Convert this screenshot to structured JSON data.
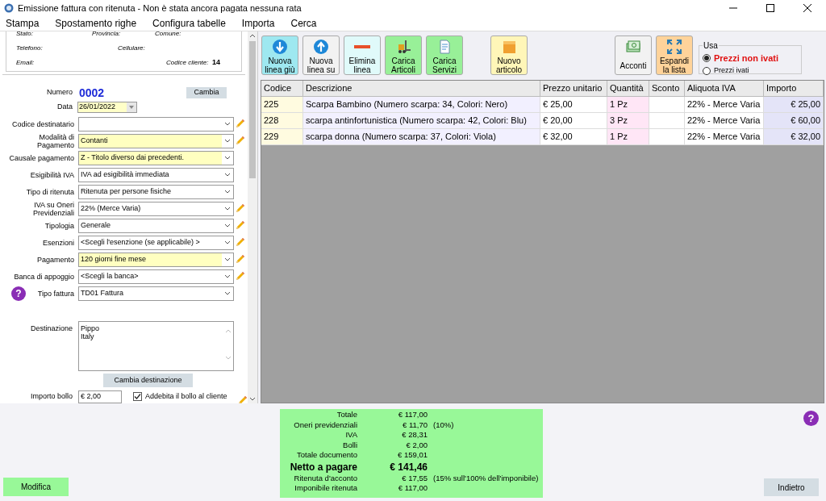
{
  "window": {
    "title": "Emissione fattura con ritenuta - Non è stata ancora pagata nessuna rata"
  },
  "menu": [
    "Stampa",
    "Spostamento righe",
    "Configura tabelle",
    "Importa",
    "Cerca"
  ],
  "customer": {
    "stato": "Stato:",
    "provincia": "Provincia:",
    "comune": "Comune:",
    "telefono": "Telefono:",
    "cellulare": "Cellulare:",
    "email": "Email:",
    "codice_label": "Codice cliente:",
    "codice": "14"
  },
  "numero": {
    "label": "Numero",
    "value": "0002",
    "button": "Cambia"
  },
  "data": {
    "label": "Data",
    "value": "26/01/2022"
  },
  "fields": [
    {
      "label": "Codice destinatario",
      "highlighted": false,
      "editable": true
    },
    {
      "label": "Modalità di Pagamento",
      "value": "Contanti",
      "highlighted": true,
      "editable": true
    },
    {
      "label": "Causale pagamento",
      "value": "Z - Titolo diverso dai precedenti.",
      "highlighted": true,
      "editable": false
    },
    {
      "label": "Esigibilità IVA",
      "value": "IVA ad esigibilità immediata",
      "highlighted": false,
      "editable": false
    },
    {
      "label": "Tipo di ritenuta",
      "value": "Ritenuta per persone fisiche",
      "highlighted": false,
      "editable": false
    },
    {
      "label": "IVA su Oneri Previdenziali",
      "value": "22% (Merce Varia)",
      "highlighted": false,
      "editable": true
    },
    {
      "label": "Tipologia",
      "value": "Generale",
      "highlighted": false,
      "editable": true
    },
    {
      "label": "Esenzioni",
      "value": "<Scegli l'esenzione (se applicabile) >",
      "highlighted": false,
      "editable": true
    },
    {
      "label": "Pagamento",
      "value": "120 giorni fine mese",
      "highlighted": true,
      "editable": true
    },
    {
      "label": "Banca di appoggio",
      "value": "<Scegli la banca>",
      "highlighted": false,
      "editable": true
    },
    {
      "label": "Tipo fattura",
      "value": "TD01 Fattura",
      "highlighted": false,
      "editable": false,
      "help": "?"
    }
  ],
  "destinazione": {
    "label": "Destinazione",
    "lines": [
      "Pippo",
      "Italy"
    ],
    "button": "Cambia destinazione"
  },
  "bollo": {
    "label": "Importo bollo",
    "value": "€ 2,00",
    "checkbox_label": "Addebita il bollo al cliente",
    "checked": true
  },
  "toolbar": [
    {
      "kind": "arrow-down",
      "label": "Nuova linea giù",
      "color": "#9ee8f0"
    },
    {
      "kind": "arrow-up",
      "label": "Nuova linea su",
      "color": "#f2f2f2"
    },
    {
      "kind": "minus",
      "label": "Elimina linea",
      "color": "#e0fafa"
    },
    {
      "kind": "forklift",
      "label": "Carica Articoli",
      "color": "#98f098"
    },
    {
      "kind": "document",
      "label": "Carica Servizi",
      "color": "#98f098"
    },
    {
      "kind": "box",
      "label": "Nuovo articolo",
      "color": "#fff6b8"
    },
    {
      "kind": "money",
      "label": "Acconti",
      "color": "#f2f2f2"
    },
    {
      "kind": "expand",
      "label": "Espandi la lista",
      "color": "#ffd39a"
    }
  ],
  "usa": {
    "title": "Usa",
    "options": [
      {
        "label": "Prezzi non ivati",
        "selected": true
      },
      {
        "label": "Prezzi ivati",
        "selected": false
      }
    ]
  },
  "table": {
    "columns": [
      "Codice",
      "Descrizione",
      "Prezzo unitario",
      "Quantità",
      "Sconto",
      "Aliquota IVA",
      "Importo"
    ],
    "rows": [
      [
        "225",
        "Scarpa Bambino (Numero scarpa: 34, Colori: Nero)",
        "€ 25,00",
        "1 Pz",
        "",
        "22% - Merce Varia",
        "€ 25,00"
      ],
      [
        "228",
        "scarpa antinfortunistica (Numero scarpa: 42, Colori: Blu)",
        "€ 20,00",
        "3 Pz",
        "",
        "22% - Merce Varia",
        "€ 60,00"
      ],
      [
        "229",
        "scarpa donna (Numero scarpa: 37, Colori: Viola)",
        "€ 32,00",
        "1 Pz",
        "",
        "22% - Merce Varia",
        "€ 32,00"
      ]
    ]
  },
  "summary": [
    {
      "label": "Totale",
      "value": "€ 117,00",
      "kind": "line"
    },
    {
      "label": "Oneri previdenziali",
      "value": "€ 11,70",
      "note": "(10%)",
      "kind": "line"
    },
    {
      "label": "IVA",
      "value": "€ 28,31",
      "kind": "line"
    },
    {
      "label": "Bolli",
      "value": "€ 2,00",
      "kind": "line"
    },
    {
      "label": "Totale documento",
      "value": "€ 159,01",
      "kind": "line"
    },
    {
      "label": "Netto a pagare",
      "value": "€ 141,46",
      "kind": "total"
    },
    {
      "label": "Ritenuta d'acconto",
      "value": "€ 17,55",
      "note": "(15% sull'100% dell'imponibile)",
      "kind": "line"
    },
    {
      "label": "Imponibile ritenuta",
      "value": "€ 117,00",
      "kind": "line"
    }
  ],
  "help_button": "?",
  "buttons": {
    "modifica": "Modifica",
    "indietro": "Indietro"
  }
}
